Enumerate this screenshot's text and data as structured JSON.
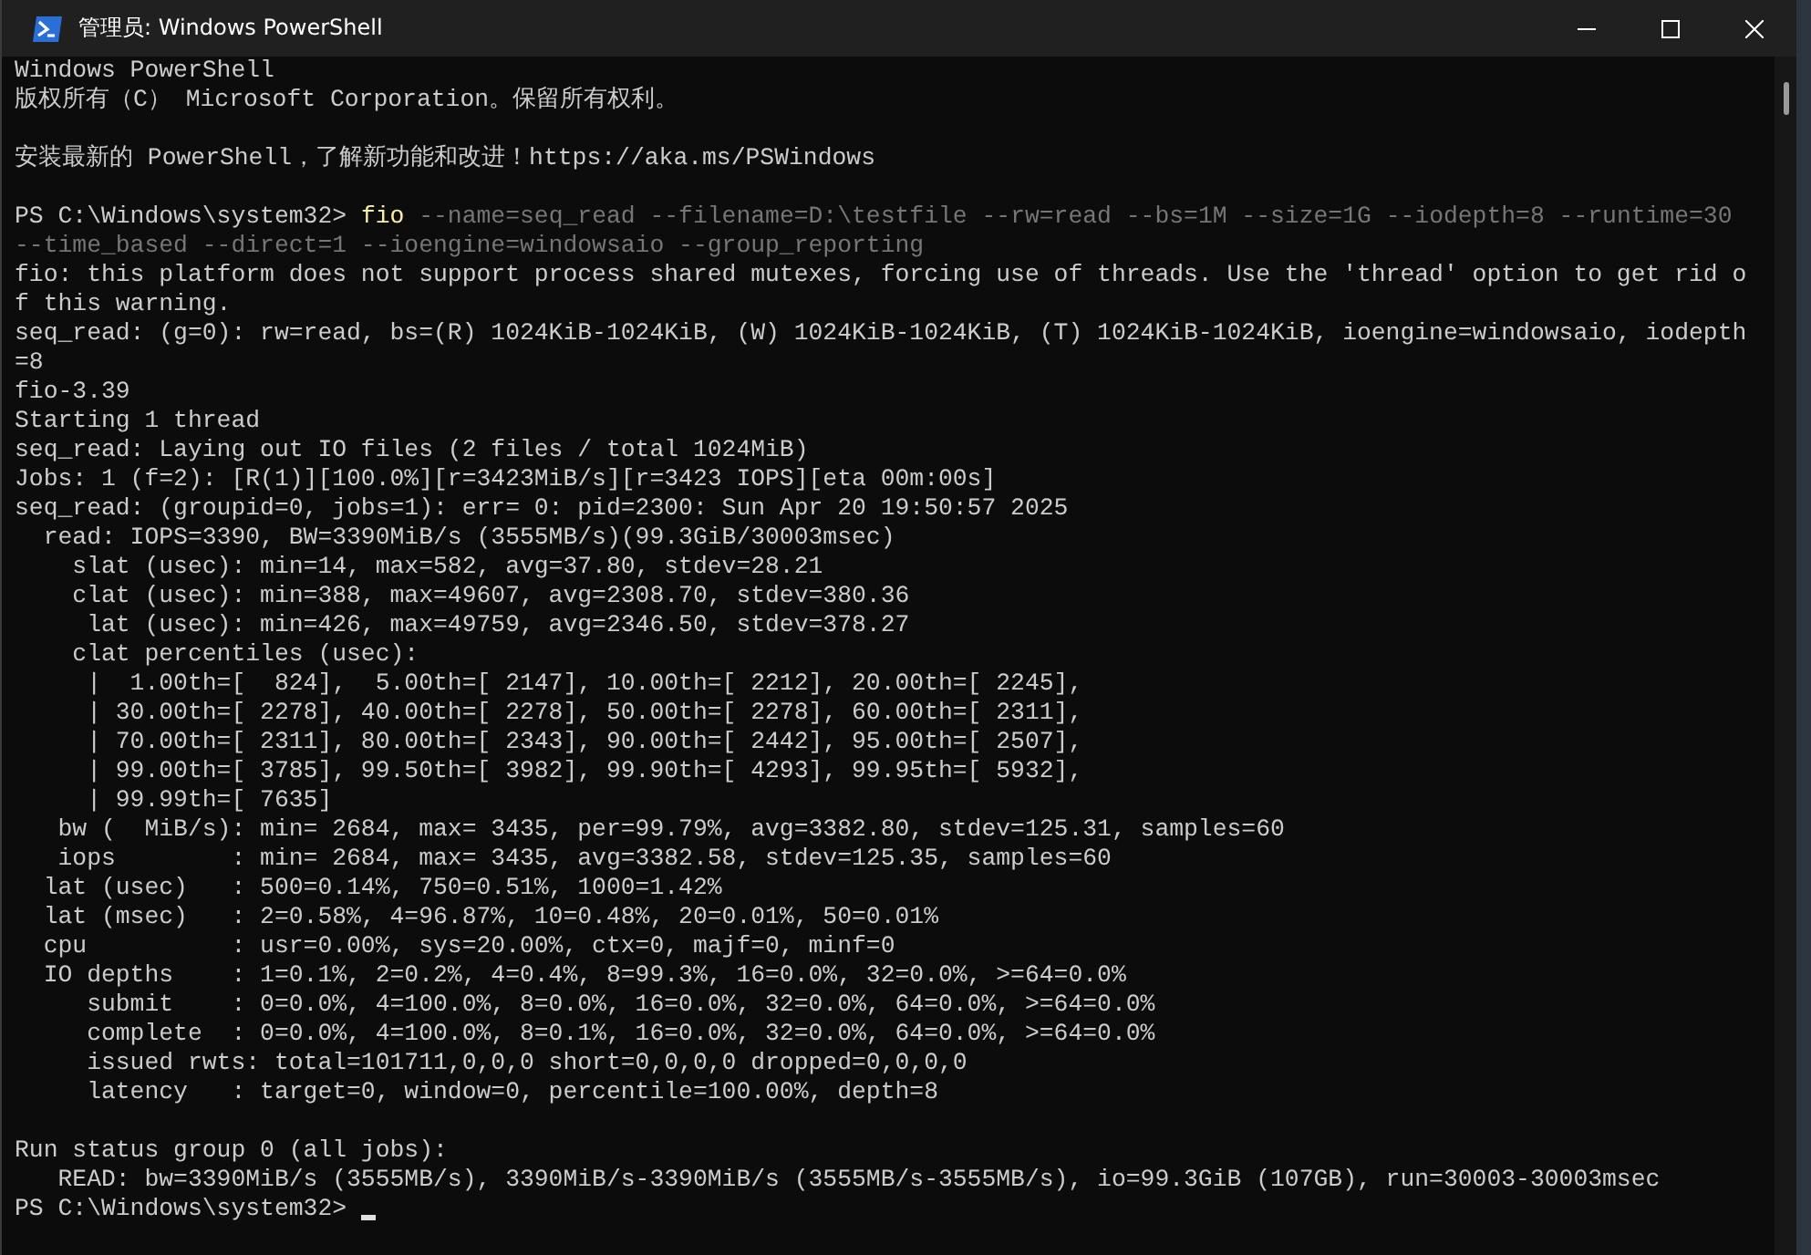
{
  "window": {
    "title": "管理员: Windows PowerShell"
  },
  "terminal": {
    "blocks": [
      {
        "lines": [
          [
            {
              "text": "Windows PowerShell",
              "kind": "output"
            }
          ],
          [
            {
              "text": "版权所有（C） Microsoft Corporation。保留所有权利。",
              "kind": "output"
            }
          ]
        ]
      },
      {
        "lines": [
          [
            {
              "text": "安装最新的 PowerShell，了解新功能和改进！https://aka.ms/PSWindows",
              "kind": "output"
            }
          ]
        ]
      },
      {
        "lines": [
          [
            {
              "text": "PS C:\\Windows\\system32> ",
              "kind": "output"
            },
            {
              "text": "fio",
              "kind": "command"
            },
            {
              "text": " --name=seq_read --filename=D:\\testfile --rw=read --bs=1M --size=1G --iodepth=8 --runtime=30",
              "kind": "argument"
            }
          ],
          [
            {
              "text": "--time_based --direct=1 --ioengine=windowsaio --group_reporting",
              "kind": "argument"
            }
          ],
          [
            {
              "text": "fio: this platform does not support process shared mutexes, forcing use of threads. Use the 'thread' option to get rid o",
              "kind": "output"
            }
          ],
          [
            {
              "text": "f this warning.",
              "kind": "output"
            }
          ],
          [
            {
              "text": "seq_read: (g=0): rw=read, bs=(R) 1024KiB-1024KiB, (W) 1024KiB-1024KiB, (T) 1024KiB-1024KiB, ioengine=windowsaio, iodepth",
              "kind": "output"
            }
          ],
          [
            {
              "text": "=8",
              "kind": "output"
            }
          ],
          [
            {
              "text": "fio-3.39",
              "kind": "output"
            }
          ],
          [
            {
              "text": "Starting 1 thread",
              "kind": "output"
            }
          ],
          [
            {
              "text": "seq_read: Laying out IO files (2 files / total 1024MiB)",
              "kind": "output"
            }
          ],
          [
            {
              "text": "Jobs: 1 (f=2): [R(1)][100.0%][r=3423MiB/s][r=3423 IOPS][eta 00m:00s]",
              "kind": "output"
            }
          ],
          [
            {
              "text": "seq_read: (groupid=0, jobs=1): err= 0: pid=2300: Sun Apr 20 19:50:57 2025",
              "kind": "output"
            }
          ],
          [
            {
              "text": "  read: IOPS=3390, BW=3390MiB/s (3555MB/s)(99.3GiB/30003msec)",
              "kind": "output"
            }
          ],
          [
            {
              "text": "    slat (usec): min=14, max=582, avg=37.80, stdev=28.21",
              "kind": "output"
            }
          ],
          [
            {
              "text": "    clat (usec): min=388, max=49607, avg=2308.70, stdev=380.36",
              "kind": "output"
            }
          ],
          [
            {
              "text": "     lat (usec): min=426, max=49759, avg=2346.50, stdev=378.27",
              "kind": "output"
            }
          ],
          [
            {
              "text": "    clat percentiles (usec):",
              "kind": "output"
            }
          ],
          [
            {
              "text": "     |  1.00th=[  824],  5.00th=[ 2147], 10.00th=[ 2212], 20.00th=[ 2245],",
              "kind": "output"
            }
          ],
          [
            {
              "text": "     | 30.00th=[ 2278], 40.00th=[ 2278], 50.00th=[ 2278], 60.00th=[ 2311],",
              "kind": "output"
            }
          ],
          [
            {
              "text": "     | 70.00th=[ 2311], 80.00th=[ 2343], 90.00th=[ 2442], 95.00th=[ 2507],",
              "kind": "output"
            }
          ],
          [
            {
              "text": "     | 99.00th=[ 3785], 99.50th=[ 3982], 99.90th=[ 4293], 99.95th=[ 5932],",
              "kind": "output"
            }
          ],
          [
            {
              "text": "     | 99.99th=[ 7635]",
              "kind": "output"
            }
          ],
          [
            {
              "text": "   bw (  MiB/s): min= 2684, max= 3435, per=99.79%, avg=3382.80, stdev=125.31, samples=60",
              "kind": "output"
            }
          ],
          [
            {
              "text": "   iops        : min= 2684, max= 3435, avg=3382.58, stdev=125.35, samples=60",
              "kind": "output"
            }
          ],
          [
            {
              "text": "  lat (usec)   : 500=0.14%, 750=0.51%, 1000=1.42%",
              "kind": "output"
            }
          ],
          [
            {
              "text": "  lat (msec)   : 2=0.58%, 4=96.87%, 10=0.48%, 20=0.01%, 50=0.01%",
              "kind": "output"
            }
          ],
          [
            {
              "text": "  cpu          : usr=0.00%, sys=20.00%, ctx=0, majf=0, minf=0",
              "kind": "output"
            }
          ],
          [
            {
              "text": "  IO depths    : 1=0.1%, 2=0.2%, 4=0.4%, 8=99.3%, 16=0.0%, 32=0.0%, >=64=0.0%",
              "kind": "output"
            }
          ],
          [
            {
              "text": "     submit    : 0=0.0%, 4=100.0%, 8=0.0%, 16=0.0%, 32=0.0%, 64=0.0%, >=64=0.0%",
              "kind": "output"
            }
          ],
          [
            {
              "text": "     complete  : 0=0.0%, 4=100.0%, 8=0.1%, 16=0.0%, 32=0.0%, 64=0.0%, >=64=0.0%",
              "kind": "output"
            }
          ],
          [
            {
              "text": "     issued rwts: total=101711,0,0,0 short=0,0,0,0 dropped=0,0,0,0",
              "kind": "output"
            }
          ],
          [
            {
              "text": "     latency   : target=0, window=0, percentile=100.00%, depth=8",
              "kind": "output"
            }
          ]
        ]
      },
      {
        "lines": [
          [
            {
              "text": "Run status group 0 (all jobs):",
              "kind": "output"
            }
          ],
          [
            {
              "text": "   READ: bw=3390MiB/s (3555MB/s), 3390MiB/s-3390MiB/s (3555MB/s-3555MB/s), io=99.3GiB (107GB), run=30003-30003msec",
              "kind": "output"
            }
          ],
          [
            {
              "text": "PS C:\\Windows\\system32> ",
              "kind": "output"
            }
          ]
        ]
      }
    ]
  }
}
